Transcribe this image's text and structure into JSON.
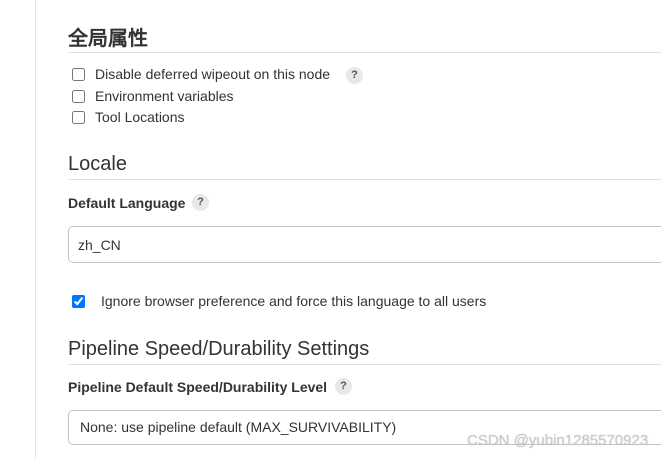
{
  "help_glyph": "?",
  "global_properties": {
    "title": "全局属性",
    "options": [
      {
        "label": "Disable deferred wipeout on this node",
        "checked": false
      },
      {
        "label": "Environment variables",
        "checked": false
      },
      {
        "label": "Tool Locations",
        "checked": false
      }
    ]
  },
  "locale": {
    "title": "Locale",
    "default_language": {
      "label": "Default Language",
      "value": "zh_CN"
    },
    "ignore_browser_preference": {
      "label": "Ignore browser preference and force this language to all users",
      "checked": true
    }
  },
  "pipeline_speed": {
    "title": "Pipeline Speed/Durability Settings",
    "default_level": {
      "label": "Pipeline Default Speed/Durability Level",
      "selected": "None: use pipeline default (MAX_SURVIVABILITY)"
    }
  },
  "watermark": "CSDN @yubin1285570923",
  "theme": {
    "accent": "#0075ff",
    "text": "#333333",
    "divider": "#e0e0e0"
  }
}
